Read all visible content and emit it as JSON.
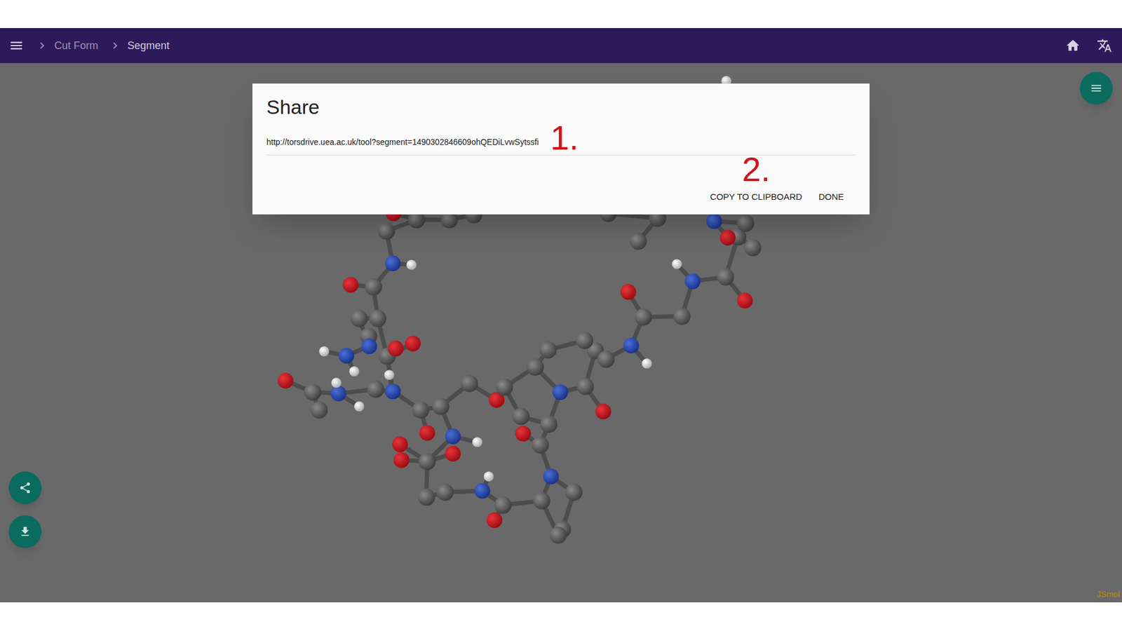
{
  "app_bar": {
    "breadcrumbs": [
      {
        "label": "Cut Form",
        "selected": false
      },
      {
        "label": "Segment",
        "selected": true
      }
    ]
  },
  "dialog": {
    "title": "Share",
    "url": "http://torsdrive.uea.ac.uk/tool?segment=1490302846609ohQEDiLvwSytssfi",
    "buttons": [
      "COPY TO CLIPBOARD",
      "DONE"
    ]
  },
  "annotations": [
    "1.",
    "2."
  ],
  "viewer": {
    "watermark": "JSmol"
  }
}
